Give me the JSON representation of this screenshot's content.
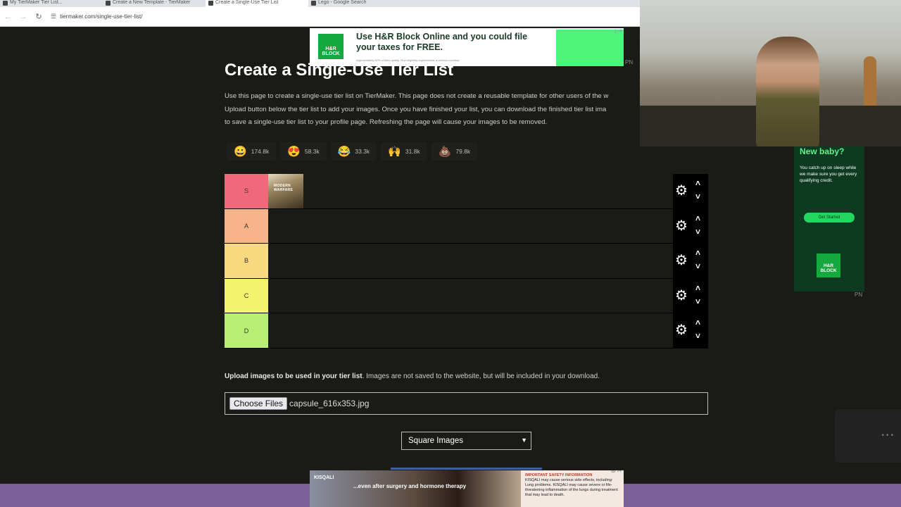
{
  "browser": {
    "tabs": [
      {
        "label": "My TierMaker Tier List..."
      },
      {
        "label": "Create a New Template - TierMaker"
      },
      {
        "label": "Create a Single-Use Tier List"
      },
      {
        "label": "Lego - Google Search"
      }
    ],
    "url": "tiermaker.com/single-use-tier-list/"
  },
  "page": {
    "title": "Create a Single-Use Tier List",
    "intro_lines": [
      "Use this page to create a single-use tier list on TierMaker. This page does not create a reusable template for other users of the w",
      "Upload button below the tier list to add your images. Once you have finished your list, you can download the finished tier list ima",
      "to save a single-use tier list to your profile page. Refreshing the page will cause your images to be removed."
    ],
    "reactions": [
      {
        "emoji": "😀",
        "count": "174.8k"
      },
      {
        "emoji": "😍",
        "count": "58.3k"
      },
      {
        "emoji": "😂",
        "count": "33.3k"
      },
      {
        "emoji": "🙌",
        "count": "31.8k"
      },
      {
        "emoji": "💩",
        "count": "79.8k"
      }
    ],
    "tiers": [
      {
        "label": "S",
        "color": "#f0697a",
        "items": [
          "MODERN WARFARE"
        ]
      },
      {
        "label": "A",
        "color": "#f7b48a",
        "items": []
      },
      {
        "label": "B",
        "color": "#f7d97f",
        "items": []
      },
      {
        "label": "C",
        "color": "#f3f36e",
        "items": []
      },
      {
        "label": "D",
        "color": "#b9ee74",
        "items": []
      }
    ],
    "upload_bold": "Upload images to be used in your tier list",
    "upload_rest": ". Images are not saved to the website, but will be included in your download.",
    "choose_files": "Choose Files",
    "file_name": "capsule_616x353.jpg",
    "image_mode": "Square Images"
  },
  "ads": {
    "top_headline": "Use H&R Block Online and you could file your taxes for FREE.",
    "top_small": "Approximately 52% of filers qualify. Find eligibility requirements at hrblock.com/free",
    "logo_text": "H&R BLOCK",
    "pn": "PN",
    "side_heading": "New baby?",
    "side_body": "You catch up on sleep while we make sure you get every qualifying credit.",
    "side_button": "Get Started",
    "bottom_brand": "KISQALI",
    "bottom_tag": "...even after surgery and hormone therapy",
    "bottom_safety_title": "IMPORTANT SAFETY INFORMATION",
    "bottom_safety_body": "KISQALI may cause serious side effects, including: Lung problems. KISQALI may cause severe or life-threatening inflammation of the lungs during treatment that may lead to death."
  }
}
